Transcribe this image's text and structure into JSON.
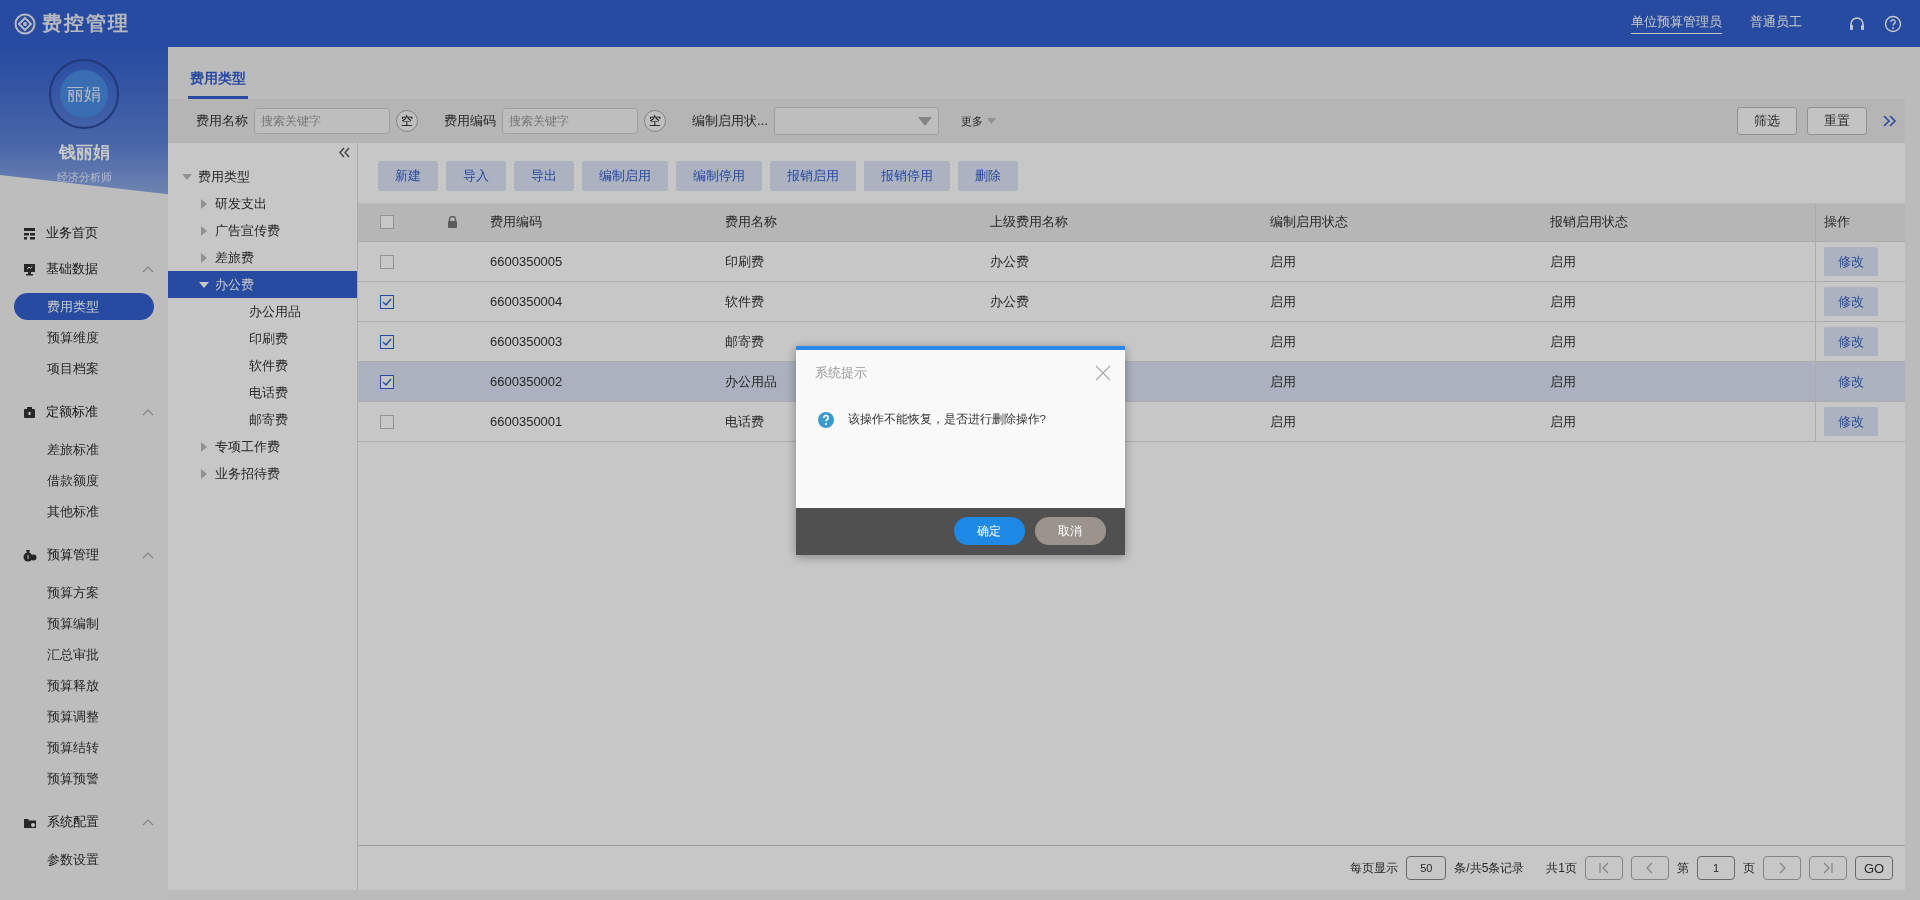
{
  "app": {
    "logo_text": "费控管理"
  },
  "top_bar": {
    "roles": [
      {
        "label": "单位预算管理员",
        "selected": true
      },
      {
        "label": "普通员工",
        "selected": false
      }
    ]
  },
  "user": {
    "avatar_text": "丽娟",
    "name": "钱丽娟",
    "title": "经济分析师"
  },
  "sidebar": {
    "items": [
      {
        "label": "业务首页"
      },
      {
        "label": "基础数据",
        "expanded": true,
        "children": [
          {
            "label": "费用类型",
            "selected": true
          },
          {
            "label": "预算维度",
            "selected": false
          },
          {
            "label": "项目档案",
            "selected": false
          }
        ]
      },
      {
        "label": "定额标准",
        "expanded": true,
        "children": [
          {
            "label": "差旅标准",
            "selected": false
          },
          {
            "label": "借款额度",
            "selected": false
          },
          {
            "label": "其他标准",
            "selected": false
          }
        ]
      },
      {
        "label": "预算管理",
        "expanded": true,
        "children": [
          {
            "label": "预算方案",
            "selected": false
          },
          {
            "label": "预算编制",
            "selected": false
          },
          {
            "label": "汇总审批",
            "selected": false
          },
          {
            "label": "预算释放",
            "selected": false
          },
          {
            "label": "预算调整",
            "selected": false
          },
          {
            "label": "预算结转",
            "selected": false
          },
          {
            "label": "预算预警",
            "selected": false
          }
        ]
      },
      {
        "label": "系统配置",
        "expanded": true,
        "children": [
          {
            "label": "参数设置",
            "selected": false
          }
        ]
      }
    ]
  },
  "tabs": [
    {
      "label": "费用类型",
      "selected": true
    }
  ],
  "filters": [
    {
      "kind": "text",
      "label": "费用名称",
      "placeholder": "搜索关键字",
      "clear_label": "空"
    },
    {
      "kind": "text",
      "label": "费用编码",
      "placeholder": "搜索关键字",
      "clear_label": "空"
    },
    {
      "kind": "select",
      "label": "编制启用状..."
    }
  ],
  "more_label": "更多",
  "filter_buttons": [
    "筛选",
    "重置"
  ],
  "tree": {
    "label": "费用类型",
    "expanded": true,
    "selected": false,
    "children": [
      {
        "label": "研发支出",
        "expanded": false,
        "selected": false
      },
      {
        "label": "广告宣传费",
        "expanded": false,
        "selected": false
      },
      {
        "label": "差旅费",
        "expanded": false,
        "selected": false
      },
      {
        "label": "办公费",
        "expanded": true,
        "selected": true,
        "children": [
          {
            "label": "办公用品",
            "selected": false
          },
          {
            "label": "印刷费",
            "selected": false
          },
          {
            "label": "软件费",
            "selected": false
          },
          {
            "label": "电话费",
            "selected": false
          },
          {
            "label": "邮寄费",
            "selected": false
          }
        ]
      },
      {
        "label": "专项工作费",
        "expanded": false,
        "selected": false
      },
      {
        "label": "业务招待费",
        "expanded": false,
        "selected": false
      }
    ]
  },
  "toolbar": [
    "新建",
    "导入",
    "导出",
    "编制启用",
    "编制停用",
    "报销启用",
    "报销停用",
    "删除"
  ],
  "table": {
    "header_checked": false,
    "columns": [
      "费用编码",
      "费用名称",
      "上级费用名称",
      "编制启用状态",
      "报销启用状态",
      "操作"
    ],
    "rows": [
      {
        "checked": false,
        "selected": false,
        "code": "6600350005",
        "name": "印刷费",
        "parent": "办公费",
        "edit_status": "启用",
        "reimb_status": "启用",
        "action": "修改"
      },
      {
        "checked": true,
        "selected": false,
        "code": "6600350004",
        "name": "软件费",
        "parent": "办公费",
        "edit_status": "启用",
        "reimb_status": "启用",
        "action": "修改"
      },
      {
        "checked": true,
        "selected": false,
        "code": "6600350003",
        "name": "邮寄费",
        "edit_status": "启用",
        "reimb_status": "启用",
        "action": "修改"
      },
      {
        "checked": true,
        "selected": true,
        "code": "6600350002",
        "name": "办公用品",
        "edit_status": "启用",
        "reimb_status": "启用",
        "action": "修改"
      },
      {
        "checked": false,
        "selected": false,
        "code": "6600350001",
        "name": "电话费",
        "edit_status": "启用",
        "reimb_status": "启用",
        "action": "修改"
      }
    ]
  },
  "pager": {
    "per_page_label": "每页显示",
    "per_page": "50",
    "records": "条/共5条记录",
    "pages": "共1页",
    "page_prefix": "第",
    "page": "1",
    "page_suffix": "页",
    "go": "GO"
  },
  "dialog": {
    "title": "系统提示",
    "message": "该操作不能恢复，是否进行删除操作?",
    "confirm": "确定",
    "cancel": "取消"
  }
}
